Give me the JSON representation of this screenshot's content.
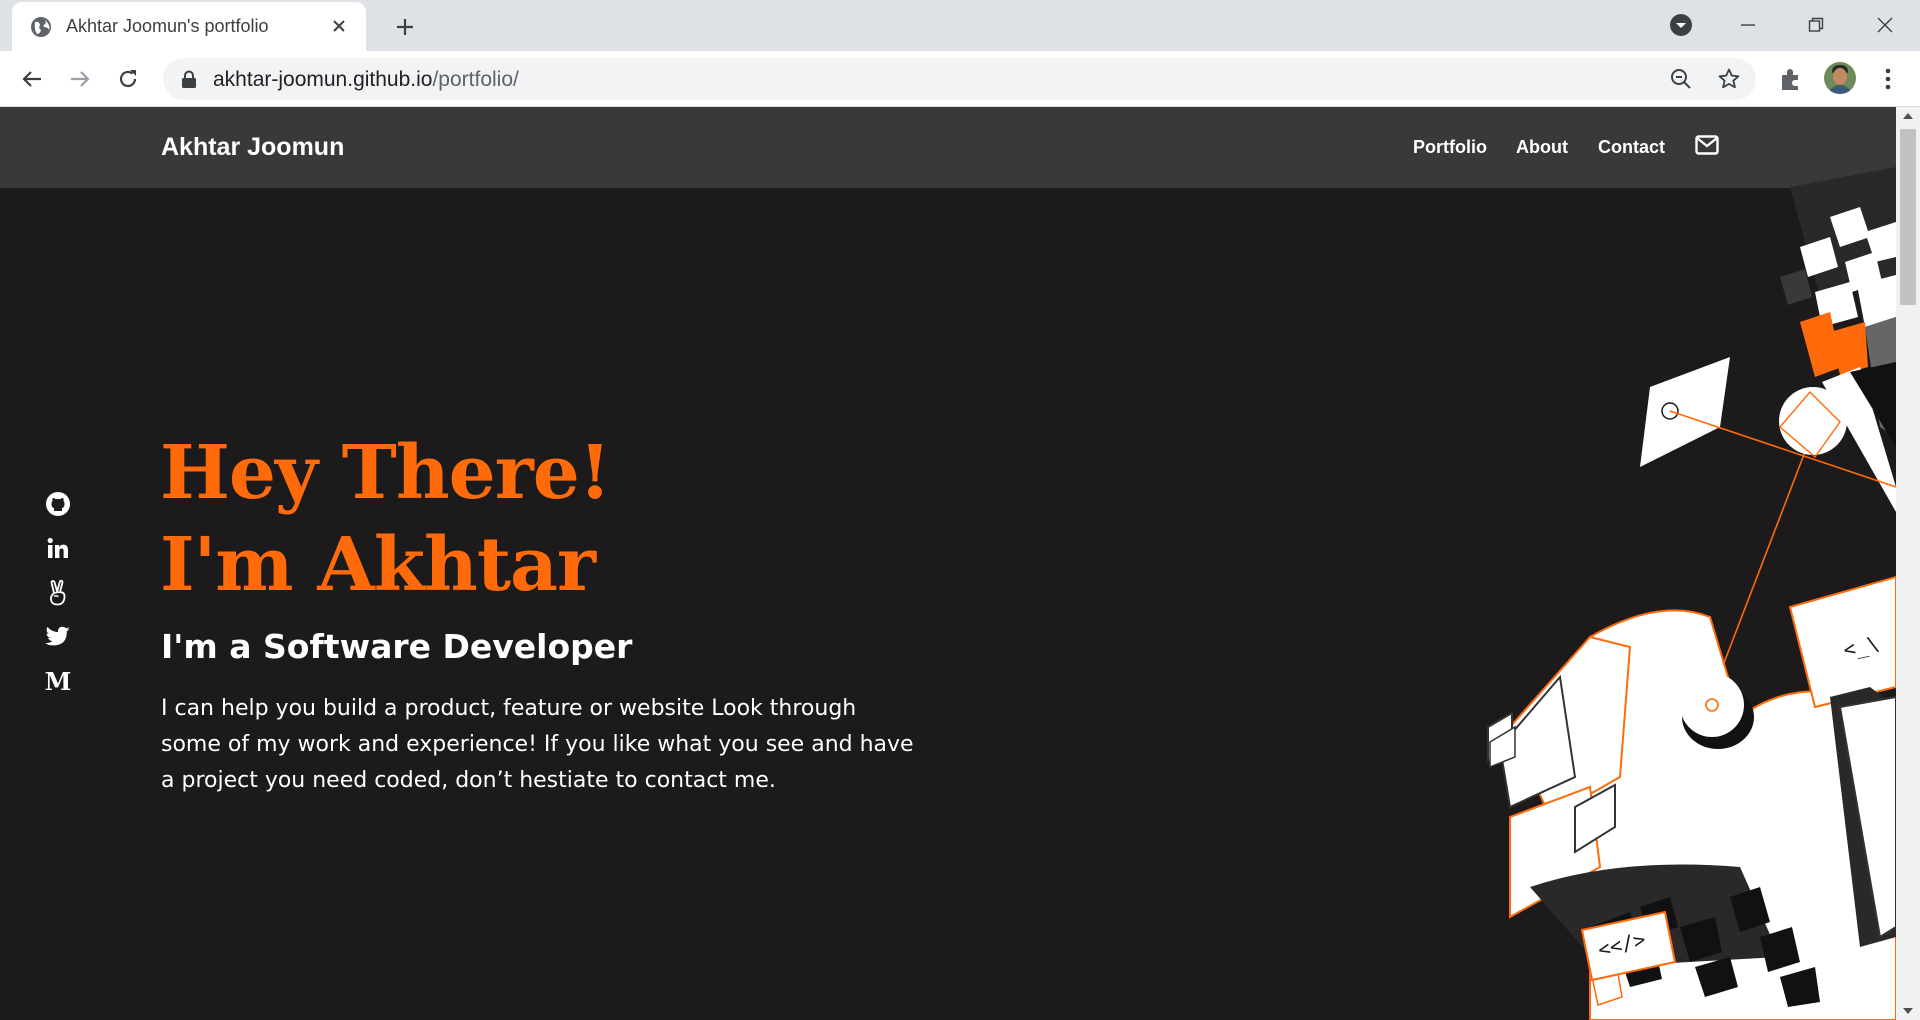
{
  "browser": {
    "tab_title": "Akhtar Joomun's portfolio",
    "url_host": "akhtar-joomun.github.io",
    "url_path": "/portfolio/",
    "icons": [
      "globe-icon",
      "close-icon",
      "plus-icon",
      "tab-search-icon",
      "minimize-icon",
      "restore-icon",
      "close-window-icon",
      "back-icon",
      "forward-icon",
      "reload-icon",
      "lock-icon",
      "zoom-icon",
      "star-icon",
      "extensions-icon",
      "profile-avatar",
      "menu-icon"
    ]
  },
  "header": {
    "brand": "Akhtar Joomun",
    "nav": [
      {
        "label": "Portfolio"
      },
      {
        "label": "About"
      },
      {
        "label": "Contact"
      }
    ],
    "mail_icon": "envelope-icon"
  },
  "socials": [
    {
      "name": "github-icon"
    },
    {
      "name": "linkedin-icon"
    },
    {
      "name": "angellist-icon"
    },
    {
      "name": "twitter-icon"
    },
    {
      "name": "medium-icon",
      "glyph": "M"
    }
  ],
  "hero": {
    "title_line1": "Hey There!",
    "title_line2": "I'm Akhtar",
    "subtitle": "I'm a Software Developer",
    "description": "I can help you build a product, feature or website Look through some of my work and experience! If you like what you see and have a project you need coded, don’t hestiate to contact me.",
    "art_code_top": "<_\\",
    "art_code_bottom": "<</>"
  },
  "colors": {
    "accent": "#ff6a0a",
    "page_bg": "#1c1a1a",
    "header_bg": "#3a3939",
    "text": "#ffffff"
  }
}
